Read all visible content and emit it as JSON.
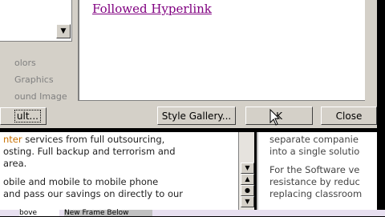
{
  "preview": {
    "followed_link": "Followed Hyperlink"
  },
  "options": [
    "olors",
    "Graphics",
    "ound Image"
  ],
  "buttons": {
    "ok_left": "ult...",
    "style_gallery": "Style Gallery...",
    "ok": "K",
    "close": "Close"
  },
  "document": {
    "para1_hl": "nter",
    "para1_rest": " services from full outsourcing,",
    "line2": "osting. Full backup and terrorism and",
    "line3": " area.",
    "line4": "obile and mobile to mobile phone",
    "line5": "and pass our savings on directly to our"
  },
  "right_pane": {
    "line1": "separate companie",
    "line2": "into a single solutio",
    "line3": "For the Software ve",
    "line4": "resistance by reduc",
    "line5": "replacing classroom"
  },
  "taskbar": {
    "item1": "bove",
    "item2": "New Frame Below"
  }
}
